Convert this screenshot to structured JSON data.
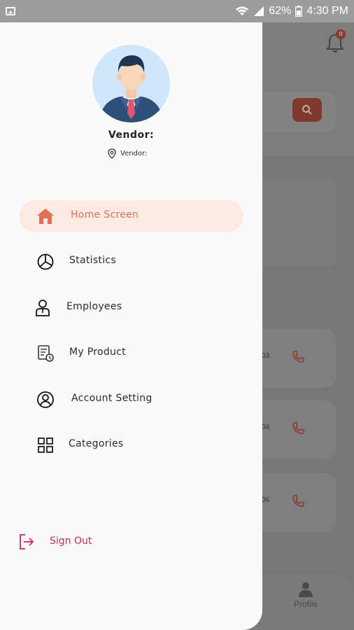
{
  "status_bar": {
    "battery": "62%",
    "time": "4:30 PM"
  },
  "background": {
    "notification_count": "0",
    "numbers": [
      "03",
      "04",
      "06"
    ],
    "bottom_nav_label": "Profile"
  },
  "drawer": {
    "vendor_name": "Vendor:",
    "vendor_location": "Vendor:",
    "menu": [
      {
        "label": "Home Screen",
        "icon": "home-icon",
        "active": true
      },
      {
        "label": "Statistics",
        "icon": "pie-chart-icon"
      },
      {
        "label": "Employees",
        "icon": "person-icon"
      },
      {
        "label": "My Product",
        "icon": "product-icon"
      },
      {
        "label": "Account Setting",
        "icon": "account-icon"
      },
      {
        "label": "Categories",
        "icon": "grid-icon"
      }
    ],
    "sign_out_label": "Sign Out"
  },
  "colors": {
    "accent": "#e07055",
    "active_bg": "#fbe9e3",
    "sign_out": "#c52a5a"
  }
}
